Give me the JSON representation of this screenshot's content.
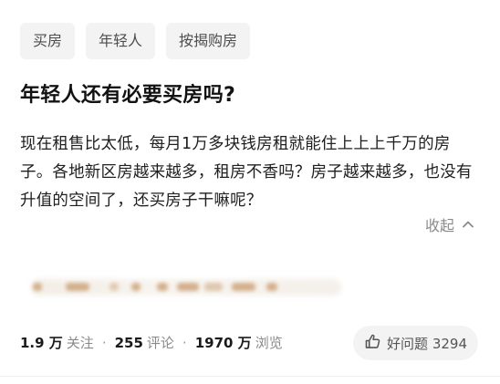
{
  "tags": [
    {
      "label": "买房"
    },
    {
      "label": "年轻人"
    },
    {
      "label": "按揭购房"
    }
  ],
  "question": {
    "title": "年轻人还有必要买房吗?",
    "body": "现在租售比太低，每月1万多块钱房租就能住上上上千万的房子。各地新区房越来越多，租房不香吗？房子越来越多，也没有升值的空间了，还买房子干嘛呢？"
  },
  "collapse": {
    "label": "收起",
    "icon": "chevron-up-icon"
  },
  "blurred_content": {
    "icon": "blurred-text"
  },
  "stats": {
    "follows_num": "1.9 万",
    "follows_label": "关注",
    "comments_num": "255",
    "comments_label": "评论",
    "views_num": "1970 万",
    "views_label": "浏览",
    "separator": "·"
  },
  "good_question": {
    "label": "好问题 3294",
    "icon": "thumbs-up-icon"
  },
  "colors": {
    "tag_bg": "#f3f3f4",
    "muted_text": "#8a8a8a",
    "primary_text": "#121212"
  }
}
